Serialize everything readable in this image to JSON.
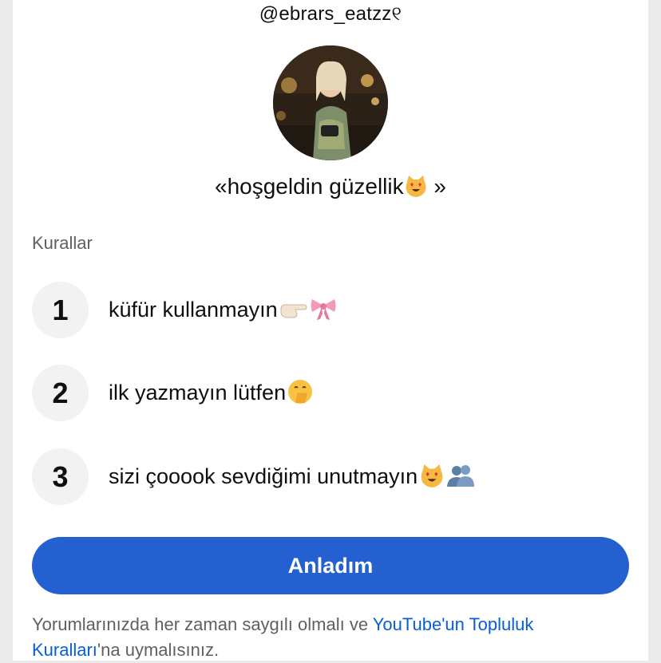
{
  "header": {
    "handle": "@ebrars_eatzz୧",
    "welcome_text": "«hoşgeldin güzellik",
    "welcome_end": " »"
  },
  "rules": {
    "section_label": "Kurallar",
    "items": [
      {
        "number": "1",
        "text": "küfür kullanmayın",
        "icons": [
          "pointing-hand-icon",
          "ribbon-bow-icon"
        ]
      },
      {
        "number": "2",
        "text": "ilk yazmayın lütfen",
        "icons": [
          "hand-over-mouth-face-icon"
        ]
      },
      {
        "number": "3",
        "text": "sizi çooook sevdiğimi unutmayın",
        "icons": [
          "heart-eyes-cat-icon",
          "busts-icon"
        ]
      }
    ]
  },
  "actions": {
    "confirm_label": "Anladım"
  },
  "footer": {
    "text_before": "Yorumlarınızda her zaman saygılı olmalı ve ",
    "link_text": "YouTube'un Topluluk Kuralları",
    "text_after": "'na uymalısınız."
  },
  "colors": {
    "accent": "#2460d0",
    "link": "#065fd4",
    "secondary_text": "#606060",
    "number_bg": "#f2f2f2"
  }
}
